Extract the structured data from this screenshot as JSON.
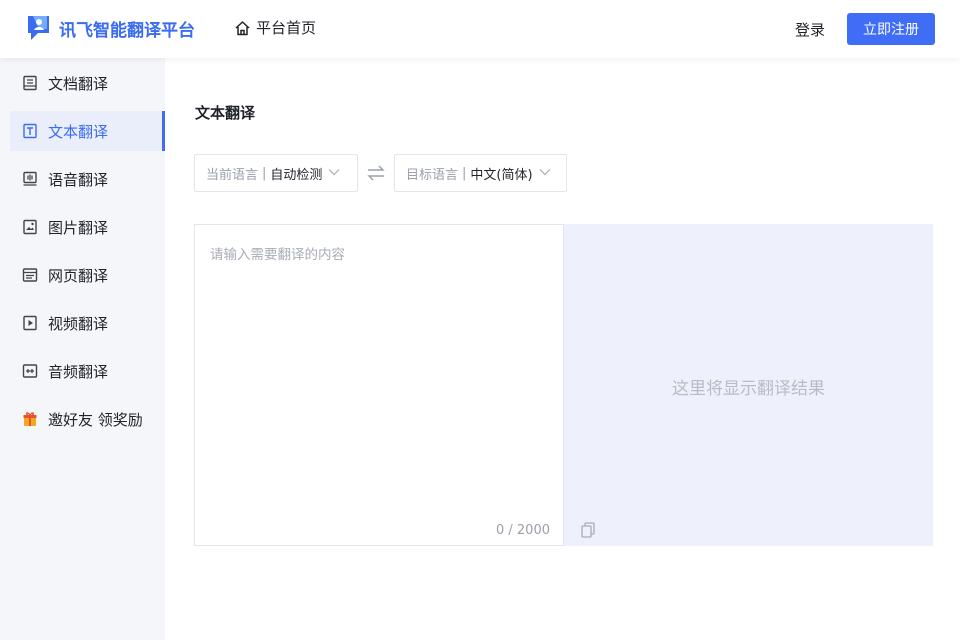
{
  "header": {
    "logo_text": "讯飞智能翻译平台",
    "home_label": "平台首页",
    "login_label": "登录",
    "register_label": "立即注册"
  },
  "sidebar": {
    "items": [
      {
        "label": "文档翻译",
        "icon": "document-icon"
      },
      {
        "label": "文本翻译",
        "icon": "text-icon",
        "active": true
      },
      {
        "label": "语音翻译",
        "icon": "voice-icon"
      },
      {
        "label": "图片翻译",
        "icon": "image-icon"
      },
      {
        "label": "网页翻译",
        "icon": "webpage-icon"
      },
      {
        "label": "视频翻译",
        "icon": "video-icon"
      },
      {
        "label": "音频翻译",
        "icon": "audio-icon"
      },
      {
        "label": "邀好友 领奖励",
        "icon": "gift-icon"
      }
    ]
  },
  "main": {
    "title": "文本翻译",
    "source_lang": {
      "label": "当前语言",
      "separator": "|",
      "value": "自动检测"
    },
    "target_lang": {
      "label": "目标语言",
      "separator": "|",
      "value": "中文(简体)"
    },
    "input": {
      "placeholder": "请输入需要翻译的内容",
      "value": "",
      "counter": "0 / 2000"
    },
    "output": {
      "placeholder": "这里将显示翻译结果"
    }
  },
  "colors": {
    "accent": "#3f6df6",
    "sidebar_bg": "#f5f6fa",
    "output_bg": "#eef0fb"
  }
}
